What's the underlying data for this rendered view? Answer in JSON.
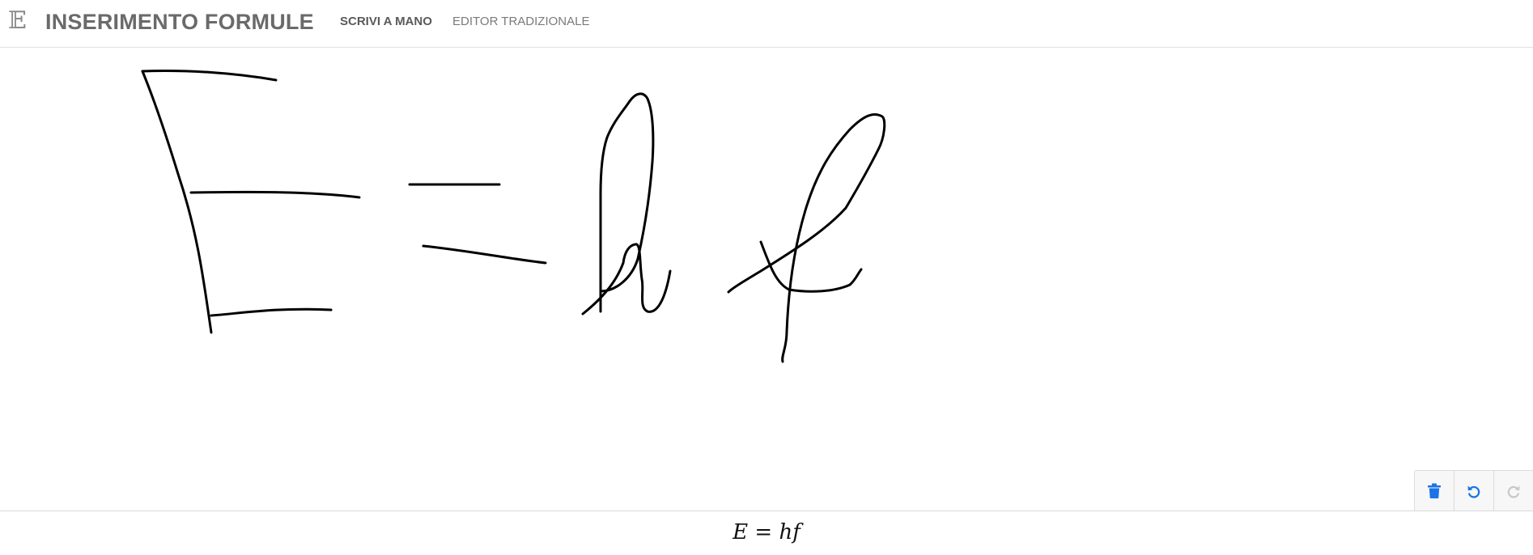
{
  "header": {
    "logo_icon": "𝔼",
    "title": "INSERIMENTO FORMULE",
    "tabs": [
      {
        "label": "SCRIVI A MANO",
        "active": true
      },
      {
        "label": "EDITOR TRADIZIONALE",
        "active": false
      }
    ]
  },
  "canvas": {
    "content": "handwritten strokes E = hf"
  },
  "toolbar": {
    "buttons": [
      {
        "icon": "trash-icon",
        "enabled": true
      },
      {
        "icon": "undo-icon",
        "enabled": true
      },
      {
        "icon": "redo-icon",
        "enabled": false
      }
    ]
  },
  "result": {
    "formula": "E = hf"
  },
  "colors": {
    "accent": "#1a73e8",
    "disabled": "#c8c8c8",
    "title": "#6a6a6a"
  }
}
